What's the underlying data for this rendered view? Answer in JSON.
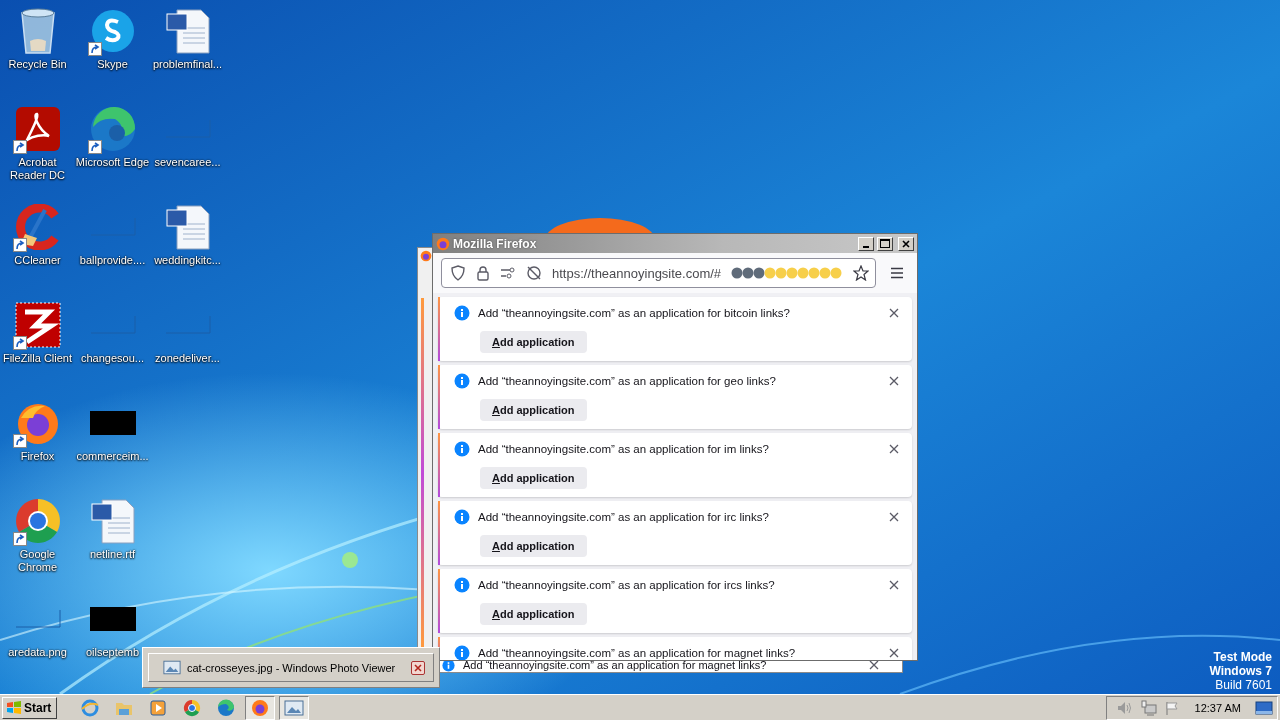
{
  "desktop": {
    "icons": [
      {
        "label": "Recycle Bin",
        "kind": "recycle",
        "shortcut": false
      },
      {
        "label": "Acrobat Reader DC",
        "kind": "pdf",
        "shortcut": true
      },
      {
        "label": "CCleaner",
        "kind": "ccleaner",
        "shortcut": true
      },
      {
        "label": "FileZilla Client",
        "kind": "filezilla",
        "shortcut": true
      },
      {
        "label": "Firefox",
        "kind": "firefox",
        "shortcut": true
      },
      {
        "label": "Google Chrome",
        "kind": "chrome",
        "shortcut": true
      },
      {
        "label": "aredata.png",
        "kind": "blank",
        "shortcut": false
      },
      {
        "label": "Skype",
        "kind": "skype",
        "shortcut": true
      },
      {
        "label": "Microsoft Edge",
        "kind": "edge",
        "shortcut": true
      },
      {
        "label": "ballprovide....",
        "kind": "blank",
        "shortcut": false
      },
      {
        "label": "changesou...",
        "kind": "blank",
        "shortcut": false
      },
      {
        "label": "commerceim...",
        "kind": "thumb",
        "shortcut": false
      },
      {
        "label": "netline.rtf",
        "kind": "word",
        "shortcut": false
      },
      {
        "label": "oilseptemb",
        "kind": "thumb",
        "shortcut": false
      },
      {
        "label": "problemfinal...",
        "kind": "word",
        "shortcut": false
      },
      {
        "label": "sevencaree...",
        "kind": "blank",
        "shortcut": false
      },
      {
        "label": "weddingkitc...",
        "kind": "word",
        "shortcut": false
      },
      {
        "label": "zonedeliver...",
        "kind": "blank",
        "shortcut": false
      }
    ],
    "system_info": [
      "Test Mode",
      "Windows 7",
      "Build 7601"
    ]
  },
  "back_window": {
    "notification": "Add “theannoyingsite.com” as an application for magnet links?"
  },
  "browser": {
    "title": "Mozilla Firefox",
    "url": "https://theannoyingsite.com/#",
    "notifications": [
      {
        "message": "Add “theannoyingsite.com” as an application for bitcoin links?",
        "button": "Add application"
      },
      {
        "message": "Add “theannoyingsite.com” as an application for geo links?",
        "button": "Add application"
      },
      {
        "message": "Add “theannoyingsite.com” as an application for im links?",
        "button": "Add application"
      },
      {
        "message": "Add “theannoyingsite.com” as an application for irc links?",
        "button": "Add application"
      },
      {
        "message": "Add “theannoyingsite.com” as an application for ircs links?",
        "button": "Add application"
      },
      {
        "message": "Add “theannoyingsite.com” as an application for magnet links?"
      }
    ]
  },
  "thumbnail_popup": {
    "title": "cat-crosseyes.jpg - Windows Photo Viewer"
  },
  "taskbar": {
    "start": "Start",
    "apps": [
      {
        "kind": "ie",
        "pressed": false
      },
      {
        "kind": "explorer",
        "pressed": false
      },
      {
        "kind": "media",
        "pressed": false
      },
      {
        "kind": "chrome",
        "pressed": false
      },
      {
        "kind": "edge",
        "pressed": false
      },
      {
        "kind": "firefox",
        "pressed": true
      },
      {
        "kind": "photos",
        "pressed": true
      }
    ],
    "clock": "12:37 AM"
  }
}
